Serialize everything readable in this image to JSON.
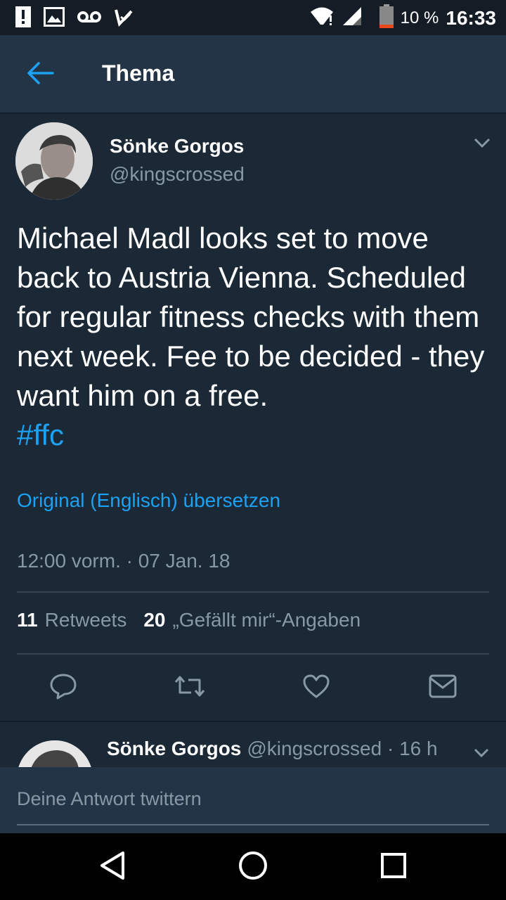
{
  "status_bar": {
    "battery_pct": "10 %",
    "time": "16:33",
    "icons": [
      "alert-icon",
      "image-icon",
      "voicemail-icon",
      "checkmark-icon",
      "wifi-icon",
      "signal-icon",
      "battery-icon"
    ]
  },
  "app_bar": {
    "title": "Thema",
    "back_icon": "arrow-left-icon"
  },
  "tweet": {
    "author_name": "Sönke Gorgos",
    "author_handle": "@kingscrossed",
    "text": "Michael Madl looks set to move back to Austria Vienna. Scheduled for regular fitness checks with them next week. Fee to be decided - they want him on a free.",
    "hashtag": "#ffc",
    "translate_label": "Original (Englisch) übersetzen",
    "timestamp": "12:00 vorm. · 07 Jan. 18",
    "retweet_count": "11",
    "retweet_label": "Retweets",
    "like_count": "20",
    "like_label": "„Gefällt mir“-Angaben",
    "actions": [
      "reply-icon",
      "retweet-icon",
      "heart-icon",
      "message-icon"
    ]
  },
  "reply_preview": {
    "author_name": "Sönke Gorgos",
    "meta": "@kingscrossed · 16 h"
  },
  "compose": {
    "placeholder": "Deine Antwort twittern"
  },
  "colors": {
    "background": "#1b2836",
    "bar": "#243447",
    "accent": "#1da1f2",
    "secondary_text": "#8899a6"
  }
}
